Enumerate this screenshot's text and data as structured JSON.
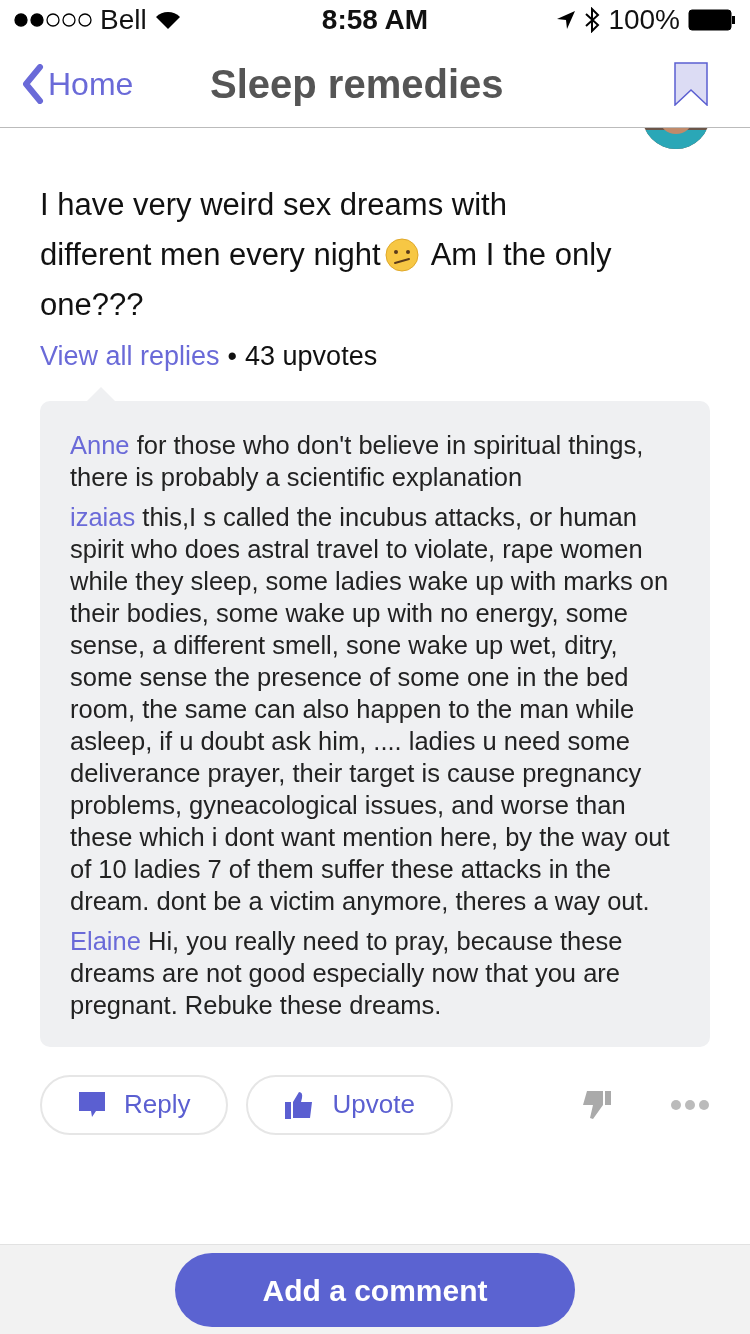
{
  "status_bar": {
    "carrier": "Bell",
    "time": "8:58 AM",
    "battery": "100%"
  },
  "nav": {
    "back": "Home",
    "title": "Sleep remedies",
    "bookmarked": false
  },
  "post": {
    "lines": [
      [
        {
          "kind": "text",
          "text": "I have very weird sex dreams with"
        }
      ],
      [
        {
          "kind": "text",
          "text": "different men every night"
        },
        {
          "kind": "emoji"
        },
        {
          "kind": "text",
          "text": "Am I the only"
        }
      ],
      [
        {
          "kind": "text",
          "text": "one???"
        }
      ]
    ],
    "view_replies": "View all replies",
    "separator": "•",
    "upvotes": "43 upvotes"
  },
  "replies": [
    {
      "author": "Anne",
      "text": "for those who don't believe in spiritual things, there is probably a scientific explanation"
    },
    {
      "author": "izaias",
      "text": "this,I s called the incubus attacks, or human spirit who does astral travel to violate, rape women while they sleep, some ladies wake up with marks on their bodies, some wake up with no energy, some sense, a different smell, sone wake up wet, ditry, some sense the presence of some one in the bed room, the same can also happen to the man while asleep, if u doubt ask him, .... ladies u need some deliverance prayer, their target is cause pregnancy problems, gyneacological issues, and worse than these which i dont want mention here, by the way out of 10 ladies 7 of them suffer these attacks in the dream. dont be a victim anymore, theres a way out."
    },
    {
      "author": "Elaine",
      "text": "Hi, you really need to pray, because these dreams are not good especially now that you are pregnant. Rebuke these dreams."
    }
  ],
  "actions": [
    {
      "kind": "reply",
      "label": "Reply"
    },
    {
      "kind": "upvote",
      "label": "Upvote"
    }
  ],
  "add_comment": "Add a comment"
}
